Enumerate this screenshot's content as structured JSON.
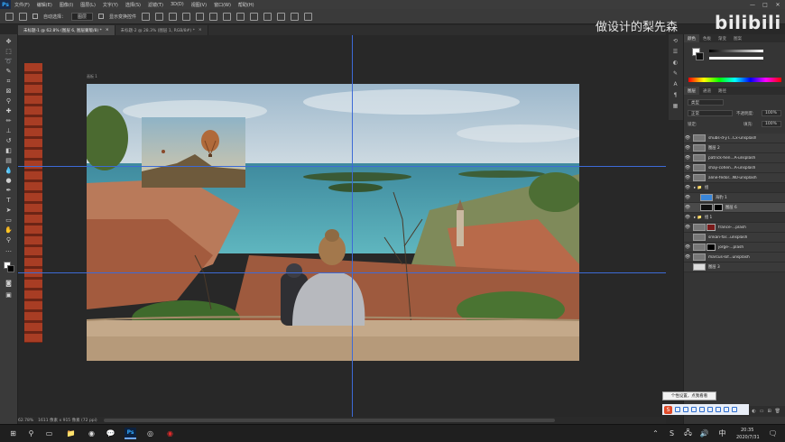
{
  "app": {
    "name": "Photoshop",
    "logo_text": "Ps",
    "menu": [
      "文件(F)",
      "编辑(E)",
      "图像(I)",
      "图层(L)",
      "文字(Y)",
      "选择(S)",
      "滤镜(T)",
      "3D(D)",
      "视图(V)",
      "窗口(W)",
      "帮助(H)"
    ],
    "window_controls": {
      "minimize": "—",
      "maximize": "□",
      "close": "✕"
    }
  },
  "options_bar": {
    "auto_select_label": "自动选择：",
    "auto_select_value": "图层",
    "show_transform_label": "显示变换控件"
  },
  "tabs": [
    {
      "label": "未标题-1 @ 62.8% (图层 6, 图层蒙版/8) *",
      "active": true
    },
    {
      "label": "未标题-2 @ 28.3% (图层 1, RGB/8#) *",
      "active": false
    }
  ],
  "artboard_label": "画板 1",
  "status_bar": {
    "zoom": "62.78%",
    "doc_info": "1611 像素 x 915 像素 (72 ppi)"
  },
  "color_panel": {
    "tabs": [
      "颜色",
      "色板",
      "渐变",
      "图案"
    ],
    "fg": "#ffffff",
    "bg": "#111111"
  },
  "layers_panel": {
    "tabs": [
      "图层",
      "通道",
      "路径"
    ],
    "filter_label": "类型",
    "blend_mode": "正常",
    "opacity_label": "不透明度:",
    "opacity_value": "100%",
    "lock_label": "锁定:",
    "fill_label": "填充:",
    "fill_value": "100%",
    "layers": [
      {
        "name": "shubs-d-yT...Cx-unsplash",
        "visible": true,
        "type": "image"
      },
      {
        "name": "图层 2",
        "visible": true,
        "type": "image"
      },
      {
        "name": "patrick-hen...A-unsplash",
        "visible": true,
        "type": "image"
      },
      {
        "name": "shay-cohen...A-unsplash",
        "visible": true,
        "type": "image"
      },
      {
        "name": "aline-fedor...N0-unsplash",
        "visible": true,
        "type": "image"
      },
      {
        "name": "组",
        "visible": true,
        "type": "group"
      },
      {
        "name": "海豹 1",
        "visible": true,
        "type": "image"
      },
      {
        "name": "图层 6",
        "visible": true,
        "type": "masked",
        "selected": true
      },
      {
        "name": "组 1",
        "visible": true,
        "type": "group"
      },
      {
        "name": "france-...plash",
        "visible": true,
        "type": "masked"
      },
      {
        "name": "srikan-far...unsplash",
        "visible": false,
        "type": "image"
      },
      {
        "name": "jorge-...plash",
        "visible": true,
        "type": "masked"
      },
      {
        "name": "marcus-lof...unsplash",
        "visible": true,
        "type": "image"
      },
      {
        "name": "图层 3",
        "visible": false,
        "type": "image"
      }
    ]
  },
  "watermark": {
    "text": "做设计的梨先森",
    "logo": "bilibili"
  },
  "tooltip": "个性设置，点我看看",
  "taskbar": {
    "time": "20:35",
    "date": "2020/7/31"
  }
}
